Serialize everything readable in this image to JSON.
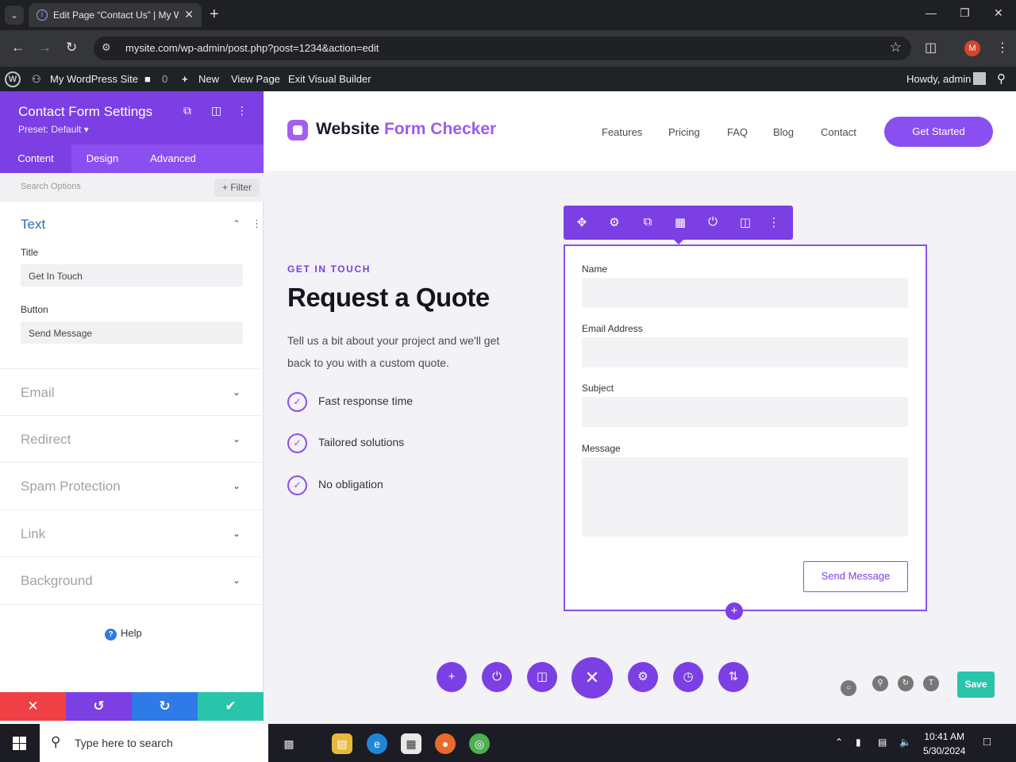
{
  "browser": {
    "tab_title": "Edit Page “Contact Us” | My Wor",
    "url": "mysite.com/wp-admin/post.php?post=1234&action=edit",
    "profile_initial": "M"
  },
  "wp_admin_bar": {
    "site_name": "My WordPress Site",
    "comments_count": "0",
    "new_label": "New",
    "view_page": "View Page",
    "exit_builder": "Exit Visual Builder",
    "howdy": "Howdy, admin"
  },
  "settings_panel": {
    "title": "Contact Form Settings",
    "preset": "Preset: Default ▾",
    "tabs": [
      {
        "label": "Content",
        "active": true
      },
      {
        "label": "Design",
        "active": false
      },
      {
        "label": "Advanced",
        "active": false
      }
    ],
    "search_placeholder": "Search Options",
    "filter_label": "Filter",
    "text_section": {
      "heading": "Text",
      "title_label": "Title",
      "title_value": "Get In Touch",
      "button_label": "Button",
      "button_value": "Send Message"
    },
    "collapsed_sections": [
      "Email",
      "Redirect",
      "Spam Protection",
      "Link",
      "Background"
    ],
    "help_label": "Help",
    "footer_colors": {
      "cancel": "#ef4145",
      "undo": "#7b3fe4",
      "redo": "#2e7ae6",
      "save": "#29c4a9"
    }
  },
  "site": {
    "logo_text": "Website ",
    "logo_accent": "Form Checker",
    "nav": [
      "Features",
      "Pricing",
      "FAQ",
      "Blog",
      "Contact"
    ],
    "cta": "Get Started",
    "eyebrow": "GET IN TOUCH",
    "heading": "Request a Quote",
    "lead": "Tell us a bit about your project and we'll get back to you with a custom quote.",
    "features": [
      "Fast response time",
      "Tailored solutions",
      "No obligation"
    ],
    "form": {
      "fields": [
        "Name",
        "Email Address",
        "Subject",
        "Message"
      ],
      "submit": "Send Message"
    },
    "save_label": "Save",
    "accent": "#7b3fe4"
  },
  "taskbar": {
    "search_placeholder": "Type here to search",
    "time": "10:41 AM",
    "date": "5/30/2024"
  }
}
